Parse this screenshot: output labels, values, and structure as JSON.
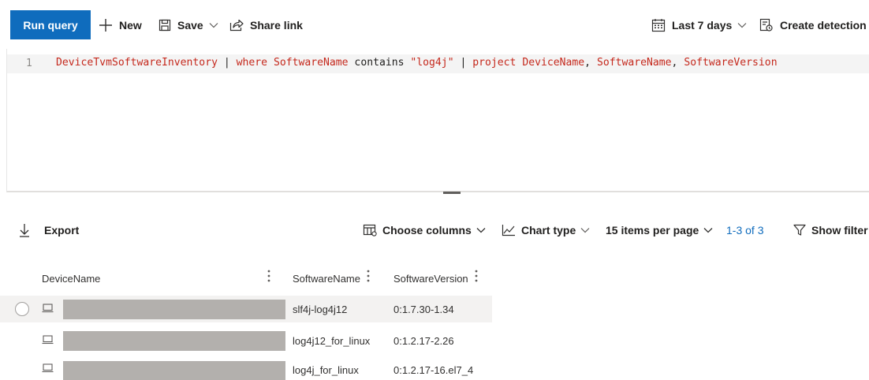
{
  "toolbar": {
    "run_query": "Run query",
    "new": "New",
    "save": "Save",
    "share_link": "Share link",
    "time_range": "Last 7 days",
    "create_detection": "Create detection"
  },
  "editor": {
    "line_number": "1",
    "tokens": {
      "table": "DeviceTvmSoftwareInventory",
      "pipe1": " | ",
      "where": "where",
      "sp1": " ",
      "field1": "SoftwareName",
      "contains": " contains ",
      "string": "\"log4j\"",
      "pipe2": " | ",
      "project": "project",
      "sp2": " ",
      "col1": "DeviceName",
      "comma1": ", ",
      "col2": "SoftwareName",
      "comma2": ", ",
      "col3": "SoftwareVersion"
    }
  },
  "results_toolbar": {
    "export": "Export",
    "choose_columns": "Choose columns",
    "chart_type": "Chart type",
    "items_per_page": "15 items per page",
    "pager": "1-3 of 3",
    "show_filter": "Show filter"
  },
  "grid": {
    "columns": [
      "DeviceName",
      "SoftwareName",
      "SoftwareVersion"
    ],
    "rows": [
      {
        "software_name": "slf4j-log4j12",
        "software_version": "0:1.7.30-1.34"
      },
      {
        "software_name": "log4j12_for_linux",
        "software_version": "0:1.2.17-2.26"
      },
      {
        "software_name": "log4j_for_linux",
        "software_version": "0:1.2.17-16.el7_4"
      }
    ]
  },
  "colors": {
    "accent": "#0f6cbd",
    "query_token": "#c5281c",
    "redaction": "#b3b0ad",
    "selected_row": "#f3f2f1"
  },
  "icons": [
    "plus-icon",
    "save-icon",
    "share-icon",
    "chevron-down-icon",
    "calendar-icon",
    "create-detection-icon",
    "export-icon",
    "columns-icon",
    "chart-icon",
    "filter-icon",
    "device-icon",
    "column-options-icon"
  ]
}
